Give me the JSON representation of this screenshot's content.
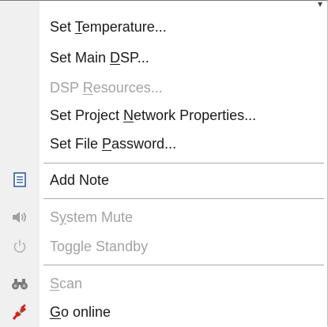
{
  "menu": {
    "items": [
      {
        "label_parts": [
          "Set ",
          "T",
          "emperature..."
        ],
        "enabled": true
      },
      {
        "label_parts": [
          "Set Main ",
          "D",
          "SP..."
        ],
        "enabled": true
      },
      {
        "label_parts": [
          "DSP ",
          "R",
          "esources..."
        ],
        "enabled": false
      },
      {
        "label_parts": [
          "Set Project ",
          "N",
          "etwork Properties..."
        ],
        "enabled": true
      },
      {
        "label_parts": [
          "Set File ",
          "P",
          "assword..."
        ],
        "enabled": true
      },
      {
        "label": "Add Note",
        "icon": "note-icon",
        "enabled": true
      },
      {
        "label_parts": [
          "S",
          "y",
          "stem Mute"
        ],
        "icon": "speaker-icon",
        "enabled": false
      },
      {
        "label": "Toggle Standby",
        "icon": "power-icon",
        "enabled": false
      },
      {
        "label_parts": [
          "",
          "S",
          "can"
        ],
        "icon": "binoculars-icon",
        "enabled": false
      },
      {
        "label_parts": [
          "",
          "G",
          "o online"
        ],
        "icon": "connect-plug-icon",
        "enabled": true
      }
    ]
  },
  "colors": {
    "gutter": "#f0f0f0",
    "text": "#1a1a1a",
    "disabled_text": "#a3a3a3",
    "separator": "#a9a9a9",
    "note_icon": "#2f5d9e",
    "plug_icon_red": "#d42020",
    "plug_icon_green": "#2e8b2e"
  }
}
